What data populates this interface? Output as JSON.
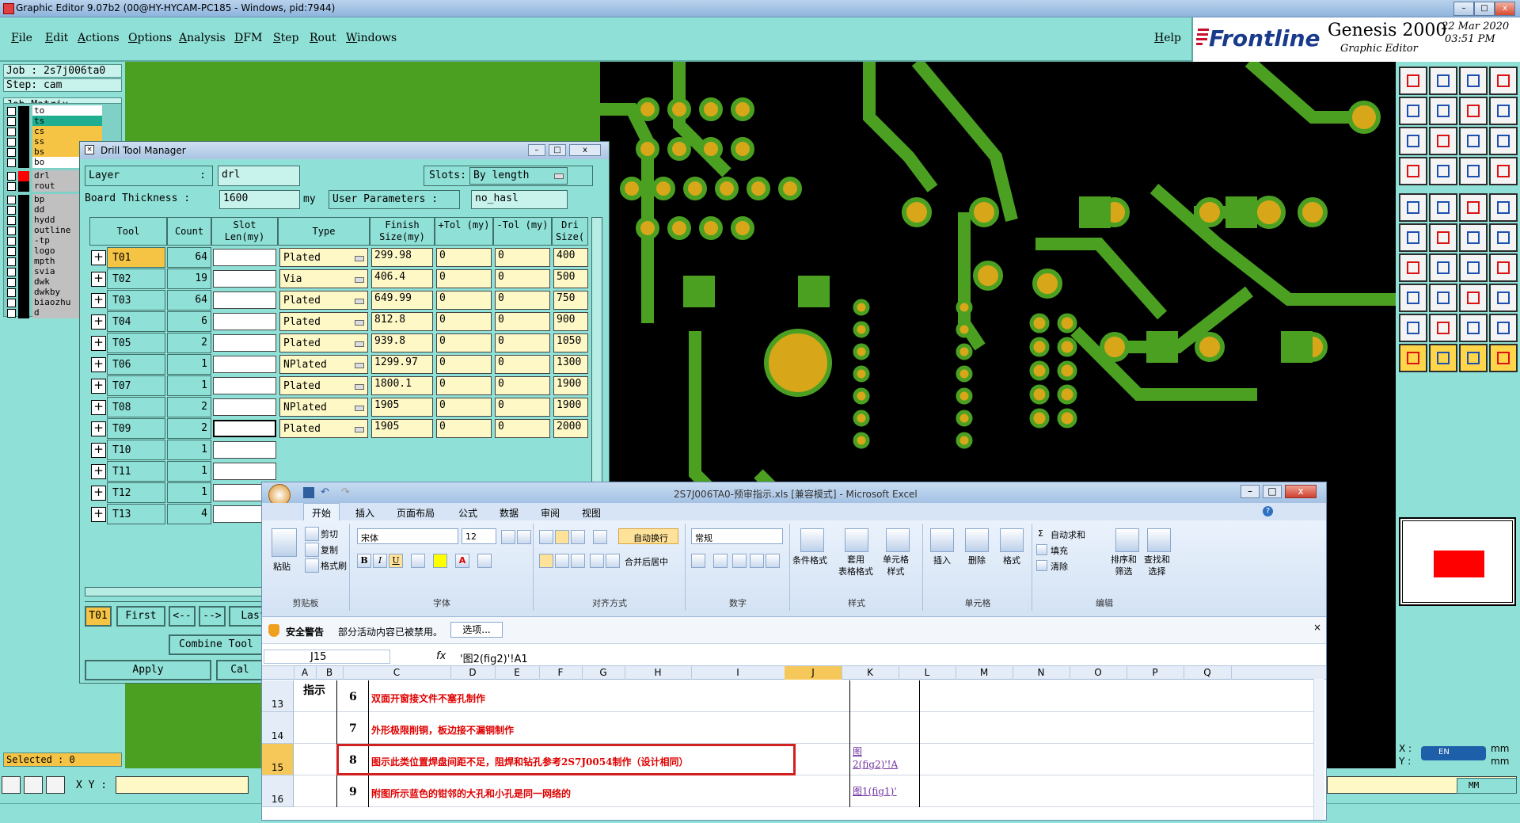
{
  "window": {
    "title": "Graphic Editor 9.07b2 (00@HY-HYCAM-PC185 - Windows, pid:7944)"
  },
  "menu": [
    "File",
    "Edit",
    "Actions",
    "Options",
    "Analysis",
    "DFM",
    "Step",
    "Rout",
    "Windows"
  ],
  "help_label": "Help",
  "logo": {
    "brand": "Frontline",
    "product": "Genesis 2000",
    "subtitle": "Graphic Editor",
    "date": "22 Mar 2020",
    "time": "03:51 PM"
  },
  "left_panel": {
    "job": "Job : 2s7j006ta0",
    "step": "Step: cam",
    "job_matrix": "Job Matrix ...",
    "layers": [
      {
        "name": "to",
        "color": "#ffffff"
      },
      {
        "name": "ts",
        "color": "#1fae8f"
      },
      {
        "name": "cs",
        "color": "#f6c444"
      },
      {
        "name": "ss",
        "color": "#f6c444"
      },
      {
        "name": "bs",
        "color": "#f6c444"
      },
      {
        "name": "bo",
        "color": "#ffffff"
      },
      {
        "name": "drl",
        "color": "#c0c0c0"
      },
      {
        "name": "rout",
        "color": "#c0c0c0"
      },
      {
        "name": "bp",
        "color": "#c0c0c0"
      },
      {
        "name": "dd",
        "color": "#c0c0c0"
      },
      {
        "name": "hydd",
        "color": "#c0c0c0"
      },
      {
        "name": "outline",
        "color": "#c0c0c0"
      },
      {
        "name": "-tp",
        "color": "#c0c0c0"
      },
      {
        "name": "logo",
        "color": "#c0c0c0"
      },
      {
        "name": "mpth",
        "color": "#c0c0c0"
      },
      {
        "name": "svia",
        "color": "#c0c0c0"
      },
      {
        "name": "dwk",
        "color": "#c0c0c0"
      },
      {
        "name": "dwkby",
        "color": "#c0c0c0"
      },
      {
        "name": "biaozhu",
        "color": "#c0c0c0"
      },
      {
        "name": "d",
        "color": "#c0c0c0"
      }
    ],
    "selected": "Selected : 0",
    "xy_label": "X Y :"
  },
  "drill": {
    "title": "Drill Tool Manager",
    "layer_label": "Layer",
    "layer_value": "drl",
    "slots_label": "Slots:",
    "slots_value": "By length",
    "thickness_label": "Board Thickness :",
    "thickness_value": "1600",
    "thickness_unit": "my",
    "user_params_label": "User Parameters :",
    "user_params_value": "no_hasl",
    "headers": [
      "Tool",
      "Count",
      "Slot Len(my)",
      "Type",
      "Finish Size(my)",
      "+Tol (my)",
      "-Tol (my)",
      "Dri Size("
    ],
    "rows": [
      {
        "tool": "T01",
        "count": "64",
        "type": "Plated",
        "finish": "299.98",
        "ptol": "0",
        "ntol": "0",
        "drill": "400"
      },
      {
        "tool": "T02",
        "count": "19",
        "type": "Via",
        "finish": "406.4",
        "ptol": "0",
        "ntol": "0",
        "drill": "500"
      },
      {
        "tool": "T03",
        "count": "64",
        "type": "Plated",
        "finish": "649.99",
        "ptol": "0",
        "ntol": "0",
        "drill": "750"
      },
      {
        "tool": "T04",
        "count": "6",
        "type": "Plated",
        "finish": "812.8",
        "ptol": "0",
        "ntol": "0",
        "drill": "900"
      },
      {
        "tool": "T05",
        "count": "2",
        "type": "Plated",
        "finish": "939.8",
        "ptol": "0",
        "ntol": "0",
        "drill": "1050"
      },
      {
        "tool": "T06",
        "count": "1",
        "type": "NPlated",
        "finish": "1299.97",
        "ptol": "0",
        "ntol": "0",
        "drill": "1300"
      },
      {
        "tool": "T07",
        "count": "1",
        "type": "Plated",
        "finish": "1800.1",
        "ptol": "0",
        "ntol": "0",
        "drill": "1900"
      },
      {
        "tool": "T08",
        "count": "2",
        "type": "NPlated",
        "finish": "1905",
        "ptol": "0",
        "ntol": "0",
        "drill": "1900"
      },
      {
        "tool": "T09",
        "count": "2",
        "type": "Plated",
        "finish": "1905",
        "ptol": "0",
        "ntol": "0",
        "drill": "2000"
      },
      {
        "tool": "T10",
        "count": "1",
        "type": "",
        "finish": "",
        "ptol": "",
        "ntol": "",
        "drill": ""
      },
      {
        "tool": "T11",
        "count": "1",
        "type": "",
        "finish": "",
        "ptol": "",
        "ntol": "",
        "drill": ""
      },
      {
        "tool": "T12",
        "count": "1",
        "type": "",
        "finish": "",
        "ptol": "",
        "ntol": "",
        "drill": ""
      },
      {
        "tool": "T13",
        "count": "4",
        "type": "",
        "finish": "",
        "ptol": "",
        "ntol": "",
        "drill": ""
      }
    ],
    "current_tool": "T01",
    "nav": [
      "First",
      "<--",
      "-->",
      "Last"
    ],
    "combine": "Combine Tool",
    "apply": "Apply",
    "cancel": "Cal"
  },
  "excel": {
    "title": "2S7J006TA0-预审指示.xls [兼容模式] - Microsoft Excel",
    "tabs": [
      "开始",
      "插入",
      "页面布局",
      "公式",
      "数据",
      "审阅",
      "视图"
    ],
    "ribbon": {
      "paste": "粘贴",
      "cut": "剪切",
      "copy": "复制",
      "format_painter": "格式刷",
      "clipboard": "剪贴板",
      "font_name": "宋体",
      "font_size": "12",
      "font_group": "字体",
      "wrap": "自动换行",
      "merge": "合并后居中",
      "align_group": "对齐方式",
      "number_format": "常规",
      "number_group": "数字",
      "cond_format": "条件格式",
      "table_format": "套用\n表格格式",
      "cell_style": "单元格\n样式",
      "style_group": "样式",
      "insert": "插入",
      "delete": "删除",
      "format": "格式",
      "cells_group": "单元格",
      "autosum": "自动求和",
      "fill": "填充",
      "clear": "清除",
      "sort": "排序和\n筛选",
      "find": "查找和\n选择",
      "edit_group": "编辑"
    },
    "warning_title": "安全警告",
    "warning_text": "部分活动内容已被禁用。",
    "options_btn": "选项...",
    "name_box": "J15",
    "fx": "fx",
    "formula": "'图2(fig2)'!A1",
    "columns": [
      "A",
      "B",
      "C",
      "D",
      "E",
      "F",
      "G",
      "H",
      "I",
      "J",
      "K",
      "L",
      "M",
      "N",
      "O",
      "P",
      "Q"
    ],
    "label_a": "指示",
    "rows": [
      {
        "row": "13",
        "num": "6",
        "text": "双面开窗接文件不塞孔制作",
        "link": ""
      },
      {
        "row": "14",
        "num": "7",
        "text": "外形极限削铜，板边接不漏铜制作",
        "link": ""
      },
      {
        "row": "15",
        "num": "8",
        "text": "图示此类位置焊盘间距不足，阻焊和钻孔参考2S7J0054制作（设计相同）",
        "link": "图\n2(fig2)'!A"
      },
      {
        "row": "16",
        "num": "9",
        "text": "附图所示蓝色的钳邻的大孔和小孔是同一网络的",
        "link": "图1(fig1)'"
      }
    ]
  },
  "status": {
    "x_label": "X :",
    "y_label": "Y :",
    "x_unit": "mm",
    "y_unit": "mm",
    "mm_label": "MM",
    "lang": "EN"
  },
  "colors": {
    "panel": "#8fe0d6",
    "pcb_green": "#4ba022",
    "pad_gold": "#d7a719",
    "tool_orange": "#f6c444",
    "excel_red": "#e00000"
  }
}
